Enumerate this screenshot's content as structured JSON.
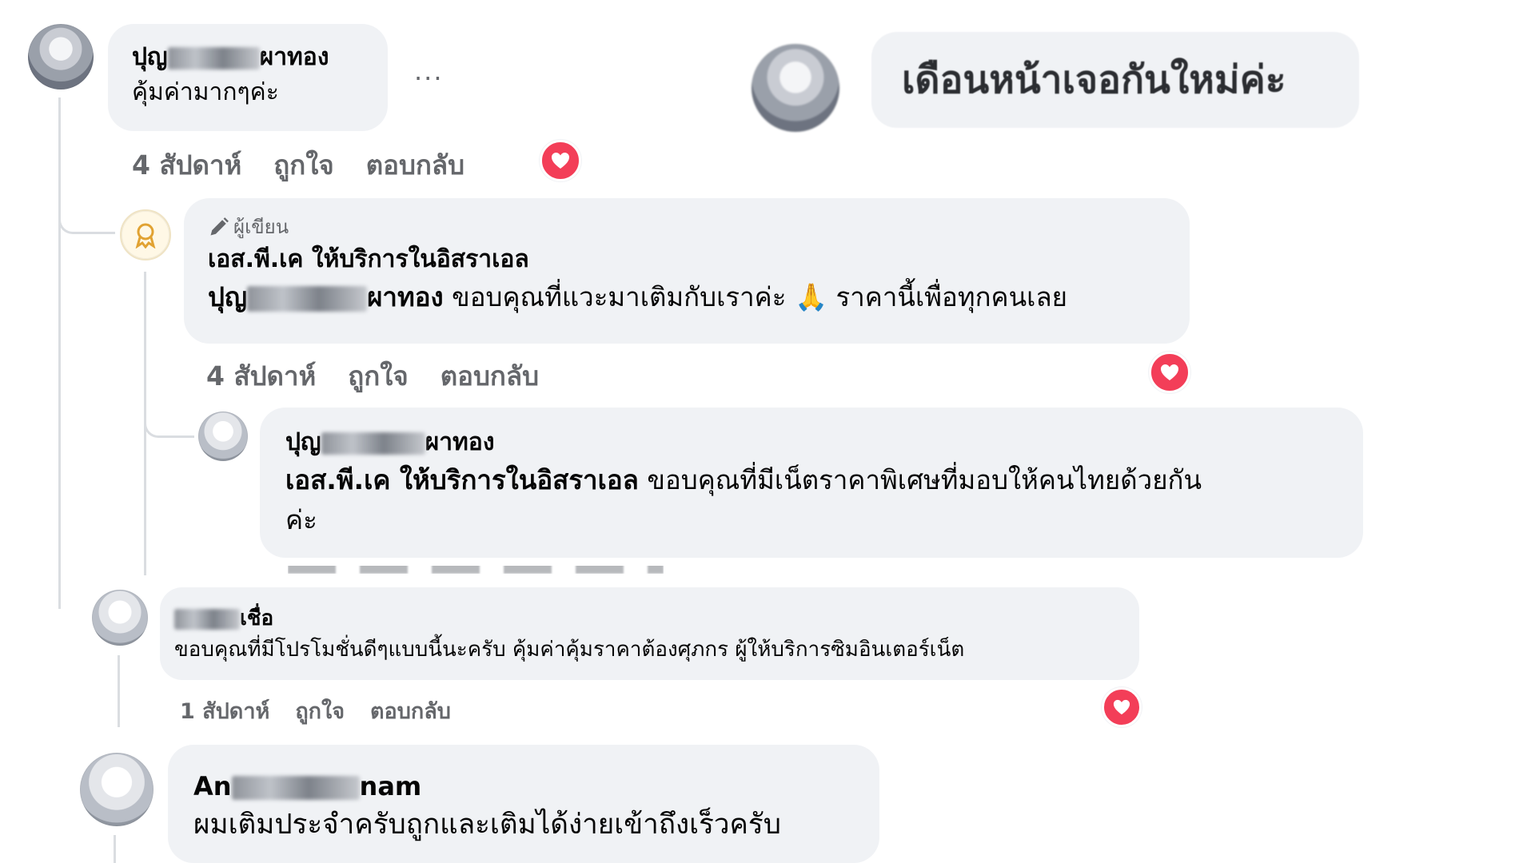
{
  "comments": [
    {
      "name_start": "ปุญ",
      "name_end": "ผาทอง",
      "text": "คุ้มค่ามากๆค่ะ",
      "time": "4 สัปดาห์",
      "like": "ถูกใจ",
      "reply": "ตอบกลับ",
      "more": "..."
    },
    {
      "author_badge": "ผู้เขียน",
      "name": "เอส.พี.เค ให้บริการในอิสราเอล",
      "mention_start": "ปุญ",
      "mention_end": "ผาทอง",
      "text_1": "ขอบคุณที่แวะมาเติมกับเราค่ะ",
      "emoji": "🙏",
      "text_2": "ราคานี้เพื่อทุกคนเลย",
      "time": "4 สัปดาห์",
      "like": "ถูกใจ",
      "reply": "ตอบกลับ"
    },
    {
      "name_start": "ปุญ",
      "name_end": "ผาทอง",
      "mention": "เอส.พี.เค ให้บริการในอิสราเอล",
      "text_1": "ขอบคุณที่มีเน็ตราคาพิเศษที่มอบให้คนไทยด้วยกัน",
      "text_2": "ค่ะ"
    },
    {
      "name_end": "เชื่อ",
      "text": "ขอบคุณที่มีโปรโมชั่นดีๆแบบนี้นะครับ คุ้มค่าคุ้มราคาต้องศุภกร ผู้ให้บริการซิมอินเตอร์เน็ต",
      "time": "1 สัปดาห์",
      "like": "ถูกใจ",
      "reply": "ตอบกลับ"
    },
    {
      "name_start": "An",
      "name_end": "nam",
      "text": "ผมเติมประจำครับถูกและเติมได้ง่ายเข้าถึงเร็วครับ"
    }
  ],
  "floating_comment": {
    "text": "เดือนหน้าเจอกันใหม่ค่ะ"
  },
  "colors": {
    "bubble": "#f0f2f5",
    "muted": "#65676b",
    "heart": "#f33e58"
  }
}
